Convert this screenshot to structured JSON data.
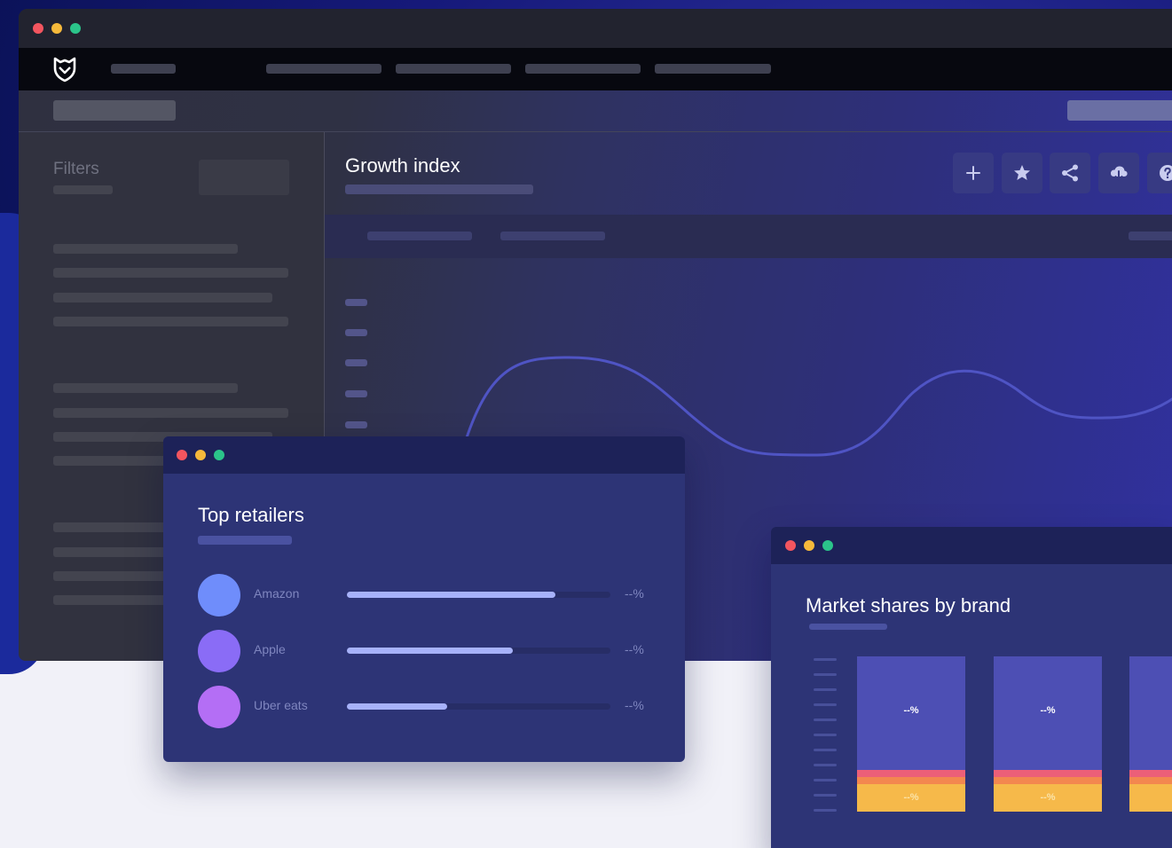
{
  "window": {
    "dots": [
      "#f3555f",
      "#f6b93b",
      "#2bc48a"
    ]
  },
  "nav": {
    "logo_icon": "fox-shield-icon"
  },
  "sidebar": {
    "filters_title": "Filters"
  },
  "growth_index": {
    "title": "Growth index",
    "toolbar": [
      {
        "icon": "plus-icon"
      },
      {
        "icon": "star-icon"
      },
      {
        "icon": "share-icon"
      },
      {
        "icon": "cloud-download-icon"
      },
      {
        "icon": "help-icon"
      }
    ]
  },
  "top_retailers": {
    "title": "Top retailers",
    "items": [
      {
        "name": "Amazon",
        "value": "--%",
        "fill": 0.79,
        "color": "#6f8dfb"
      },
      {
        "name": "Apple",
        "value": "--%",
        "fill": 0.63,
        "color": "#8a6cf6"
      },
      {
        "name": "Uber eats",
        "value": "--%",
        "fill": 0.38,
        "color": "#b46ef5"
      }
    ]
  },
  "market_shares": {
    "title": "Market shares by brand",
    "bars": [
      {
        "top_label": "--%",
        "bottom_label": "--%"
      },
      {
        "top_label": "--%",
        "bottom_label": "--%"
      },
      {
        "top_label": "--%",
        "bottom_label": "--%"
      }
    ],
    "colors": {
      "main": "#4d4fb4",
      "pink": "#ec5f78",
      "orange": "#f3874f",
      "yellow": "#f6b94a"
    }
  }
}
